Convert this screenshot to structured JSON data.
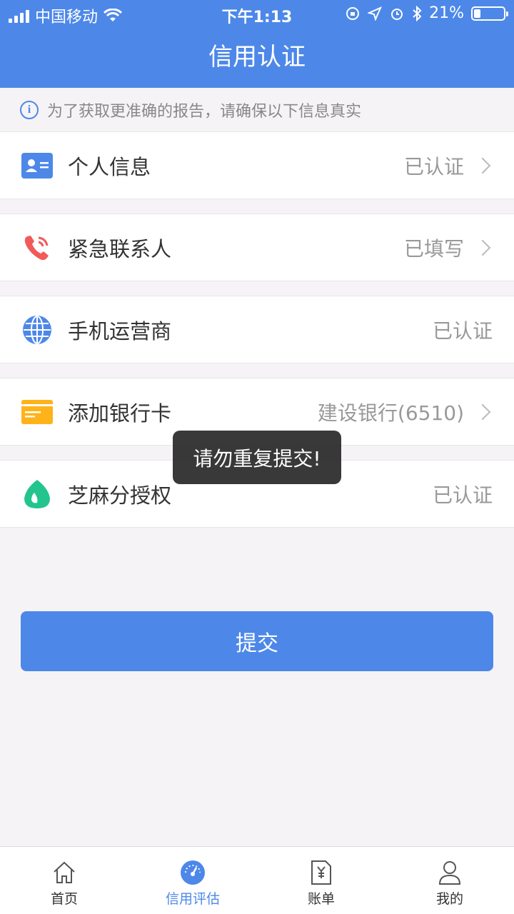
{
  "status_bar": {
    "carrier": "中国移动",
    "time": "下午1:13",
    "battery": "21%"
  },
  "header": {
    "title": "信用认证"
  },
  "notice": {
    "text": "为了获取更准确的报告，请确保以下信息真实"
  },
  "items": [
    {
      "label": "个人信息",
      "value": "已认证",
      "icon": "id-card-icon",
      "has_arrow": true,
      "color": "#4d88e9"
    },
    {
      "label": "紧急联系人",
      "value": "已填写",
      "icon": "phone-icon",
      "has_arrow": true,
      "color": "#f25a5a"
    },
    {
      "label": "手机运营商",
      "value": "已认证",
      "icon": "globe-icon",
      "has_arrow": false,
      "color": "#4d88e9"
    },
    {
      "label": "添加银行卡",
      "value": "建设银行(6510)",
      "icon": "bank-card-icon",
      "has_arrow": true,
      "color": "#ffb31a"
    },
    {
      "label": "芝麻分授权",
      "value": "已认证",
      "icon": "sesame-icon",
      "has_arrow": false,
      "color": "#23c48e"
    }
  ],
  "submit_label": "提交",
  "toast": "请勿重复提交!",
  "tabs": [
    {
      "label": "首页",
      "icon": "home-icon",
      "active": false
    },
    {
      "label": "信用评估",
      "icon": "gauge-icon",
      "active": true
    },
    {
      "label": "账单",
      "icon": "bill-icon",
      "active": false
    },
    {
      "label": "我的",
      "icon": "user-icon",
      "active": false
    }
  ],
  "colors": {
    "primary": "#4d88e9",
    "background": "#f6f3f7"
  }
}
